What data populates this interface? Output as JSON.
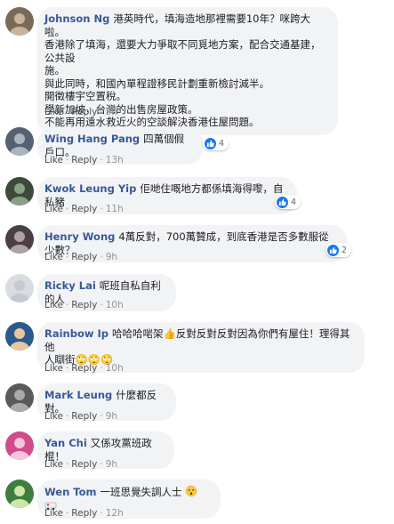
{
  "action_labels": {
    "like": "Like",
    "reply": "Reply",
    "separator": "·"
  },
  "colors": {
    "link": "#385898",
    "bubble": "#f2f3f5",
    "muted": "#90949c",
    "like_blue": "#1877f2"
  },
  "comments": [
    {
      "author": "Johnson Ng",
      "lines": [
        "港英時代，填海造地那裡需要10年？咪跨大啦。",
        "香港除了填海，還要大力爭取不同覓地方案，配合交通基建，公共設",
        "施。",
        "與此同時，和國內單程證移民計劃重新檢討減半。",
        "開徵樓宇空置稅。",
        "學新加坡，台灣的出售房屋政策。",
        "不能再用遠水救近火的空談解決香港住屋問題。"
      ],
      "time": "9h",
      "reactions": null,
      "trailing_icons": []
    },
    {
      "author": "Wing Hang Pang",
      "lines": [
        "四萬個假戶口。"
      ],
      "time": "13h",
      "reactions": "4",
      "trailing_icons": []
    },
    {
      "author": "Kwok Leung Yip",
      "lines": [
        "佢哋住嘅地方都係填海得嚟，自私豬"
      ],
      "time": "11h",
      "reactions": "4",
      "trailing_icons": []
    },
    {
      "author": "Henry Wong",
      "lines": [
        "4萬反對，700萬贊成，到底香港是否多數服從少數？"
      ],
      "time": "9h",
      "reactions": "2",
      "trailing_icons": []
    },
    {
      "author": "Ricky Lai",
      "lines": [
        "呢班自私自利的人"
      ],
      "time": "10h",
      "reactions": null,
      "trailing_icons": []
    },
    {
      "author": "Rainbow Ip",
      "lines": [
        "哈哈哈啱架👍反對反對反對因為你們有屋住！理得其他",
        "人瞓街🙄🙄🙄"
      ],
      "time": "10h",
      "reactions": null,
      "trailing_icons": []
    },
    {
      "author": "Mark Leung",
      "lines": [
        "什麼都反對。"
      ],
      "time": "9h",
      "reactions": null,
      "trailing_icons": []
    },
    {
      "author": "Yan Chi",
      "lines": [
        "又係攻黨班政棍！"
      ],
      "time": "9h",
      "reactions": null,
      "trailing_icons": []
    },
    {
      "author": "Wen Tom",
      "lines": [
        "一班思覺失調人士"
      ],
      "time": "12h",
      "reactions": null,
      "trailing_icons": [
        "dizzy-face-emoji",
        "ambulance-emoji"
      ]
    }
  ]
}
